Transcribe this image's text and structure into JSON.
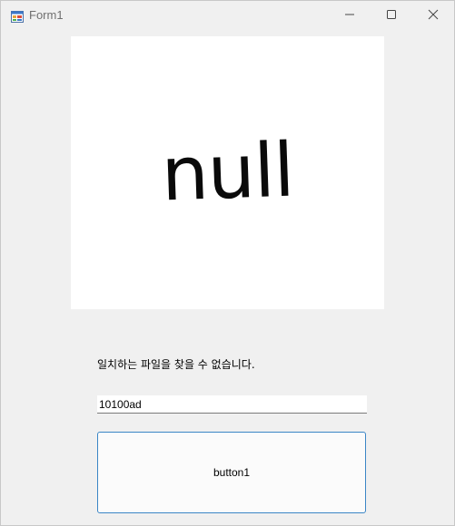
{
  "window": {
    "title": "Form1"
  },
  "picture": {
    "text": "null"
  },
  "status": {
    "message": "일치하는 파일을 찾을 수 없습니다."
  },
  "input": {
    "value": "10100ad"
  },
  "button": {
    "label": "button1"
  },
  "icons": {
    "app": "winforms-app-icon",
    "minimize": "minimize-icon",
    "maximize": "maximize-icon",
    "close": "close-icon"
  },
  "colors": {
    "window_bg": "#f0f0f0",
    "button_border": "#3a86c6",
    "title_text": "#707070"
  }
}
